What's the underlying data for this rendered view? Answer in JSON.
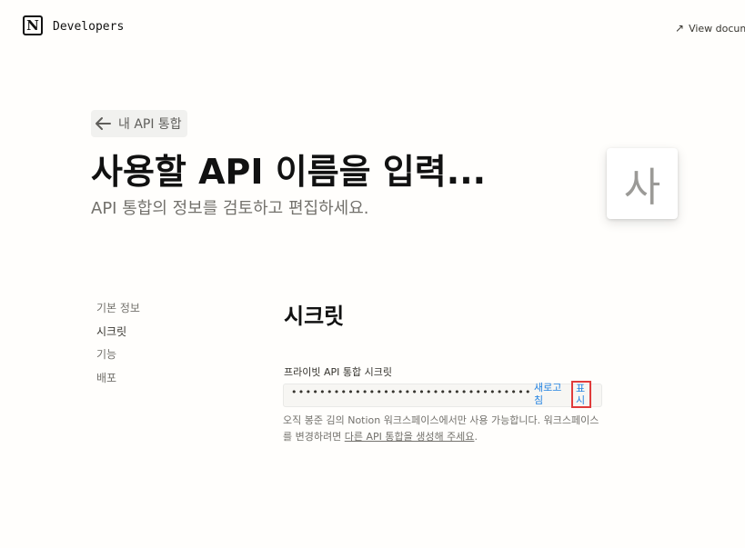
{
  "header": {
    "logo_letter": "N",
    "brand": "Developers",
    "view_docs": "View docum",
    "view_docs_icon": "arrow-up-right-icon"
  },
  "back_link": {
    "label": "내 API 통합",
    "icon": "arrow-left-icon"
  },
  "page": {
    "title": "사용할 API 이름을 입력...",
    "subtitle": "API 통합의 정보를 검토하고 편집하세요.",
    "avatar_letter": "사"
  },
  "side_nav": {
    "items": [
      "기본 정보",
      "시크릿",
      "기능",
      "배포"
    ],
    "active_index": 1
  },
  "secrets": {
    "section_title": "시크릿",
    "field_label": "프라이빗 API 통합 시크릿",
    "masked_value": "••••••••••••••••••••••••••••••••••••••••••",
    "refresh_label_1": "새로고",
    "refresh_label_2": "침",
    "show_label_1": "표",
    "show_label_2": "시",
    "help_prefix": "오직 봉준 김의 Notion 워크스페이스에서만 사용 가능합니다. 워크스페이스를 변경하려면 ",
    "help_link": "다른 API 통합을 생성해 주세요",
    "help_suffix": ".",
    "link_color": "#2383e2",
    "highlight_color": "#e03b3b"
  }
}
